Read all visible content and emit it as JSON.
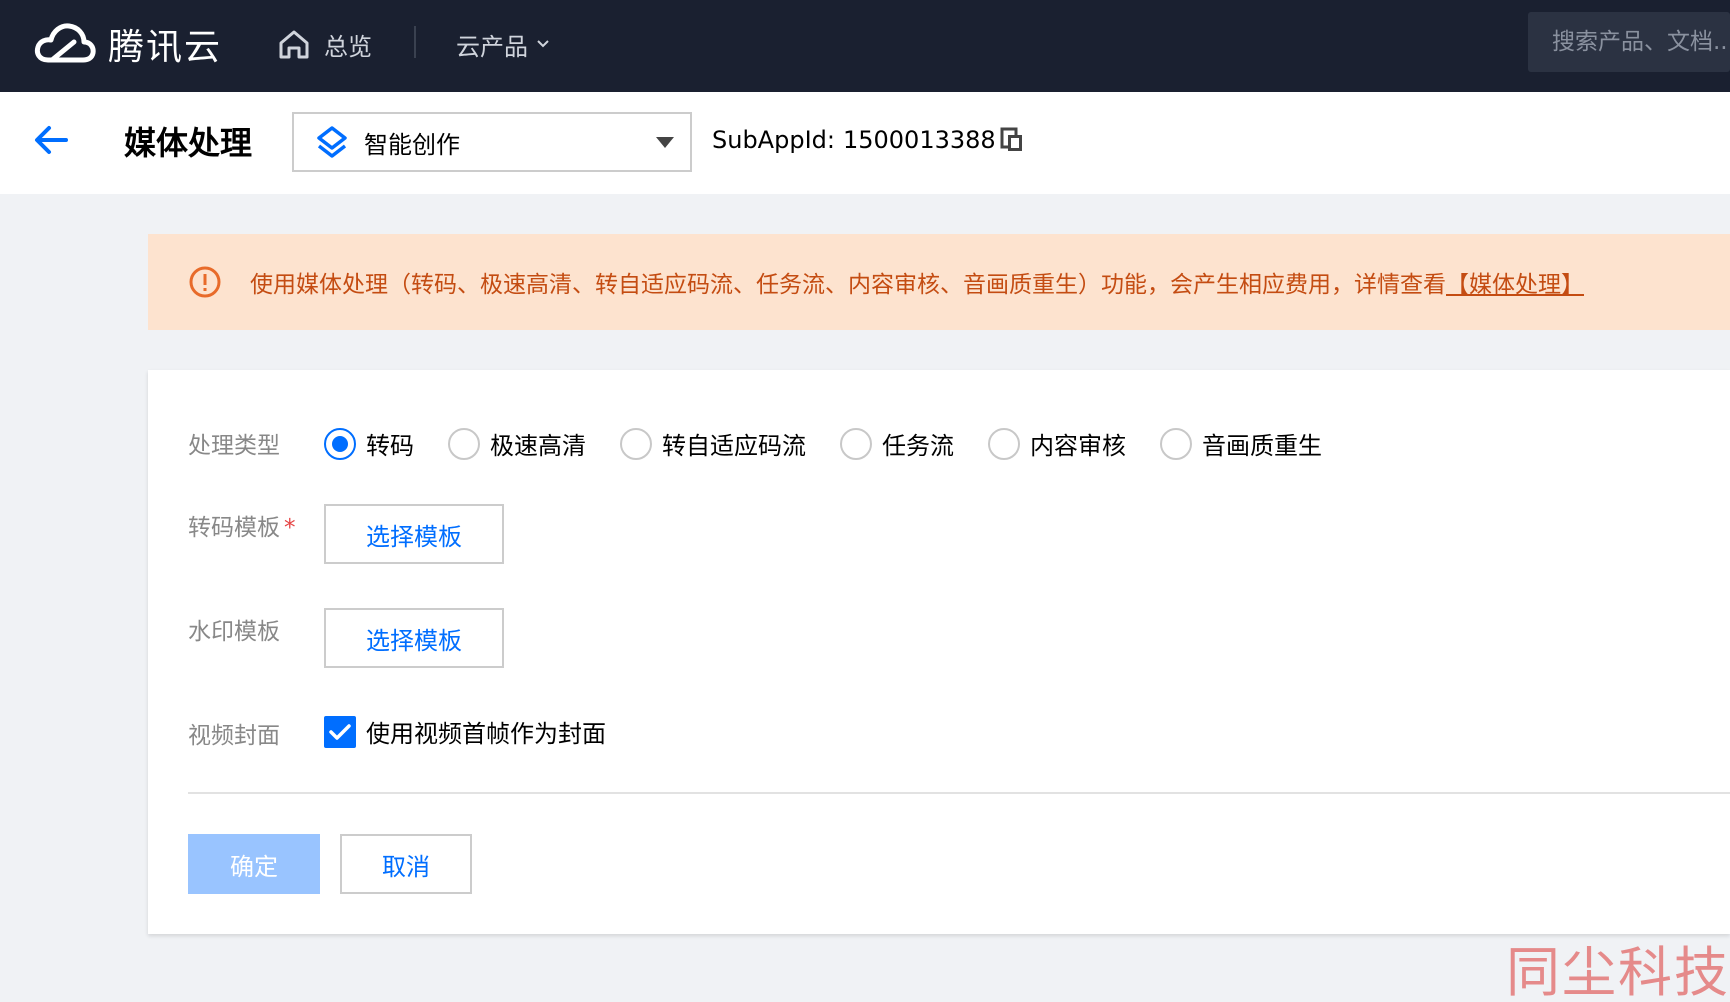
{
  "topnav": {
    "brand": "腾讯云",
    "overview_label": "总览",
    "products_label": "云产品",
    "search_placeholder": "搜索产品、文档..."
  },
  "header": {
    "title": "媒体处理",
    "app_select_value": "智能创作",
    "subappid_label": "SubAppId:",
    "subappid_value": "1500013388"
  },
  "banner": {
    "message": "使用媒体处理（转码、极速高清、转自适应码流、任务流、内容审核、音画质重生）功能，会产生相应费用，详情查看",
    "link_text": "【媒体处理】"
  },
  "form": {
    "process_type_label": "处理类型",
    "process_types": [
      {
        "label": "转码",
        "checked": true
      },
      {
        "label": "极速高清",
        "checked": false
      },
      {
        "label": "转自适应码流",
        "checked": false
      },
      {
        "label": "任务流",
        "checked": false
      },
      {
        "label": "内容审核",
        "checked": false
      },
      {
        "label": "音画质重生",
        "checked": false
      }
    ],
    "transcode_template_label": "转码模板",
    "required_mark": "*",
    "transcode_template_button": "选择模板",
    "watermark_template_label": "水印模板",
    "watermark_template_button": "选择模板",
    "cover_label": "视频封面",
    "cover_checkbox_label": "使用视频首帧作为封面",
    "cover_checked": true
  },
  "actions": {
    "confirm": "确定",
    "cancel": "取消"
  },
  "watermark_text": "同尘科技",
  "colors": {
    "topnav_bg": "#1a2030",
    "primary": "#006eff",
    "primary_disabled": "#99c4ff",
    "warning_bg": "#fde3cf",
    "warning_text": "#c44c12"
  }
}
